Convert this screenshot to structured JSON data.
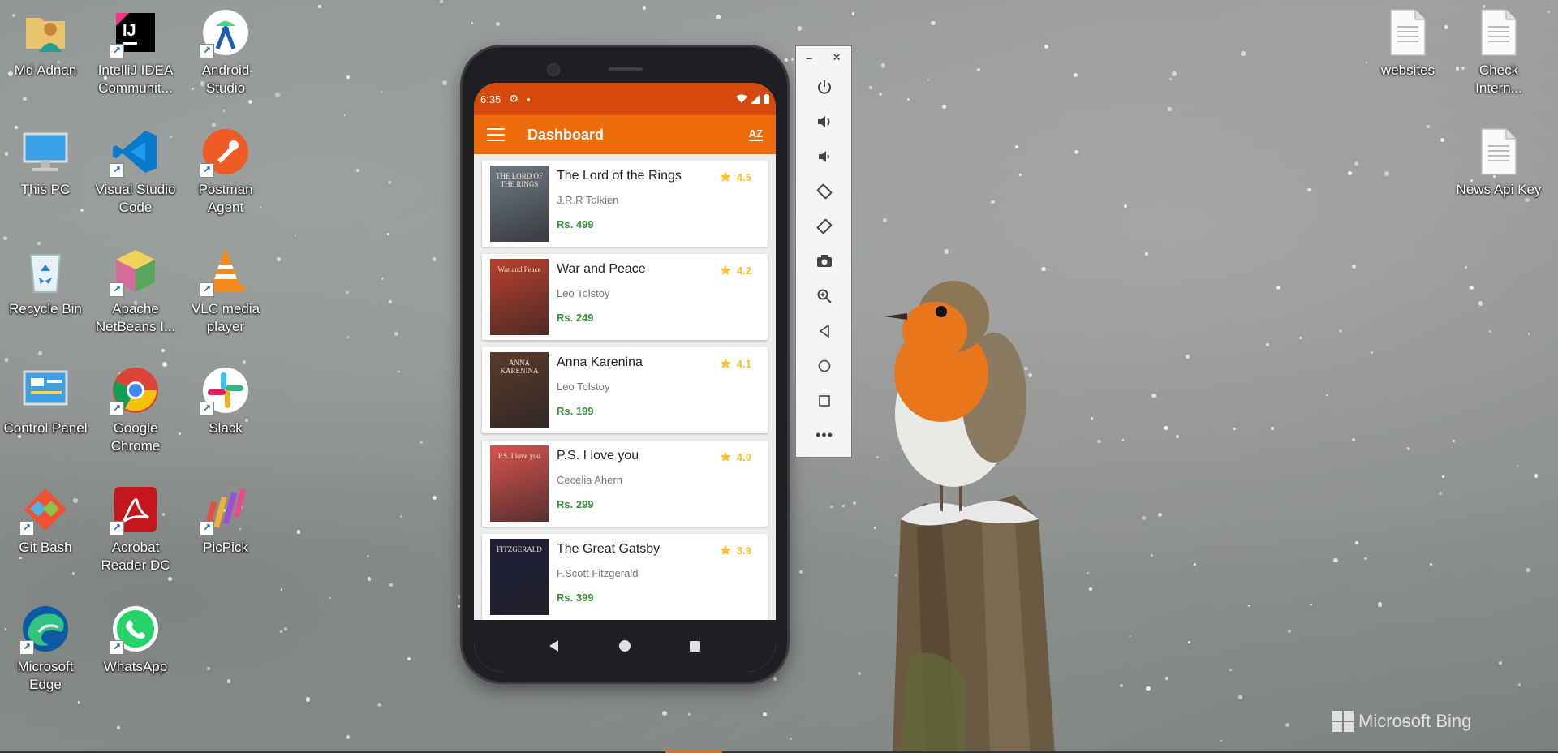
{
  "desktop": {
    "icons": [
      {
        "label": "Md Adnan",
        "icon": "user-folder-icon"
      },
      {
        "label": "IntelliJ IDEA\nCommunit...",
        "icon": "intellij-icon"
      },
      {
        "label": "Android\nStudio",
        "icon": "android-studio-icon"
      },
      {
        "label": "This PC",
        "icon": "computer-icon"
      },
      {
        "label": "Visual Studio\nCode",
        "icon": "vscode-icon"
      },
      {
        "label": "Postman\nAgent",
        "icon": "postman-icon"
      },
      {
        "label": "Recycle Bin",
        "icon": "recycle-bin-icon"
      },
      {
        "label": "Apache\nNetBeans I...",
        "icon": "netbeans-icon"
      },
      {
        "label": "VLC media\nplayer",
        "icon": "vlc-icon"
      },
      {
        "label": "Control Panel",
        "icon": "control-panel-icon"
      },
      {
        "label": "Google\nChrome",
        "icon": "chrome-icon"
      },
      {
        "label": "Slack",
        "icon": "slack-icon"
      },
      {
        "label": "Git Bash",
        "icon": "git-bash-icon"
      },
      {
        "label": "Acrobat\nReader DC",
        "icon": "acrobat-icon"
      },
      {
        "label": "PicPick",
        "icon": "picpick-icon"
      },
      {
        "label": "Microsoft\nEdge",
        "icon": "edge-icon"
      },
      {
        "label": "WhatsApp",
        "icon": "whatsapp-icon"
      },
      {
        "label": "websites",
        "icon": "file-icon"
      },
      {
        "label": "Check\nIntern...",
        "icon": "file-icon"
      },
      {
        "label": "News Api Key",
        "icon": "file-icon"
      }
    ],
    "watermark": "Microsoft Bing"
  },
  "phone": {
    "status": {
      "time": "6:35"
    },
    "appbar": {
      "title": "Dashboard",
      "sort_label": "AZ"
    },
    "books": [
      {
        "title": "The Lord of the Rings",
        "author": "J.R.R Tolkien",
        "price": "Rs. 499",
        "rating": "4.5",
        "cover_color": "#6f7a86",
        "cover_text": "THE LORD OF THE RINGS"
      },
      {
        "title": "War and Peace",
        "author": "Leo Tolstoy",
        "price": "Rs. 249",
        "rating": "4.2",
        "cover_color": "#b9402e",
        "cover_text": "War and Peace"
      },
      {
        "title": "Anna Karenina",
        "author": "Leo Tolstoy",
        "price": "Rs. 199",
        "rating": "4.1",
        "cover_color": "#5a3a2c",
        "cover_text": "ANNA KARENINA"
      },
      {
        "title": "P.S. I love you",
        "author": "Cecelia Ahern",
        "price": "Rs. 299",
        "rating": "4.0",
        "cover_color": "#d9534f",
        "cover_text": "P.S. I love you"
      },
      {
        "title": "The Great Gatsby",
        "author": "F.Scott Fitzgerald",
        "price": "Rs. 399",
        "rating": "3.9",
        "cover_color": "#1d1f3a",
        "cover_text": "FITZGERALD"
      }
    ]
  },
  "colors": {
    "status_bar": "#d34a0c",
    "app_bar": "#ef6c0a",
    "price": "#388e3c",
    "star": "#fbc02d"
  }
}
